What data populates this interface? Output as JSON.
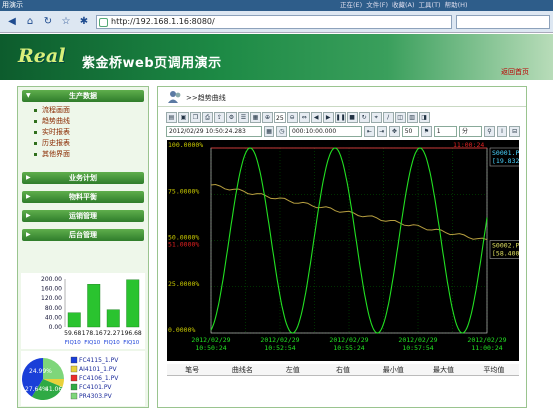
{
  "window": {
    "title": "用演示",
    "menu": [
      "正在(E)",
      "文件(F)",
      "收藏(A)",
      "工具(T)",
      "帮助(H)"
    ]
  },
  "browser": {
    "url": "http://192.168.1.16:8080/"
  },
  "banner": {
    "logo": "Real",
    "app_name": "紫金桥web页调用演示",
    "home_link": "返回首页"
  },
  "sidebar": {
    "section1": "生产数据",
    "items": [
      "流程画面",
      "趋势曲线",
      "实时报表",
      "历史报表",
      "其他界面"
    ],
    "sections": [
      "业务计划",
      "物料平衡",
      "运销管理",
      "后台管理"
    ]
  },
  "minichart": {
    "yticks": [
      "200.00",
      "160.00",
      "120.00",
      "80.00",
      "40.00",
      "0.00"
    ],
    "values": [
      59.68,
      178.16,
      72.27,
      196.68
    ],
    "value_labels": [
      "59.68",
      "178.16",
      "72.27",
      "196.68"
    ],
    "categories": [
      "FIQ10",
      "FIQ10",
      "FIQ10",
      "FIQ10"
    ]
  },
  "pie": {
    "labels": [
      "24.99%",
      "27.64%",
      "41.06%"
    ],
    "legend": [
      "FC4115_1.PV",
      "AI4101_1.PV",
      "FC4106_1.PV",
      "FC4101.PV",
      "PR4303.PV"
    ],
    "colors": [
      "#1a3fd8",
      "#e8d13a",
      "#ea2b2b",
      "#2faa45",
      "#7ed67a"
    ]
  },
  "main": {
    "breadcrumb": ">>趋势曲线",
    "toolbar": {
      "num1": "25",
      "num2": "50",
      "num3": "1",
      "unit": "分"
    },
    "time_start": "2012/02/29 10:50:24.283",
    "time_span": "000:10:00.000",
    "trend": {
      "ylabels_top": [
        "100.0000%",
        "75.0000%",
        "50.0000%",
        "25.0000%",
        "0.0000%"
      ],
      "ylabel_red": "51.0000%",
      "timestamp_top": "11:00:24",
      "xlabels": [
        [
          "2012/02/29",
          "10:50:24"
        ],
        [
          "2012/02/29",
          "10:52:54"
        ],
        [
          "2012/02/29",
          "10:55:24"
        ],
        [
          "2012/02/29",
          "10:57:54"
        ],
        [
          "2012/02/29",
          "11:00:24"
        ]
      ],
      "tag1": {
        "name": "S0001.PV",
        "value": "[19.8324]"
      },
      "tag2": {
        "name": "S0002.PV",
        "value": "[58.4000]"
      }
    },
    "table_headers": [
      "笔号",
      "曲线名",
      "左值",
      "右值",
      "最小值",
      "最大值",
      "平均值"
    ]
  }
}
